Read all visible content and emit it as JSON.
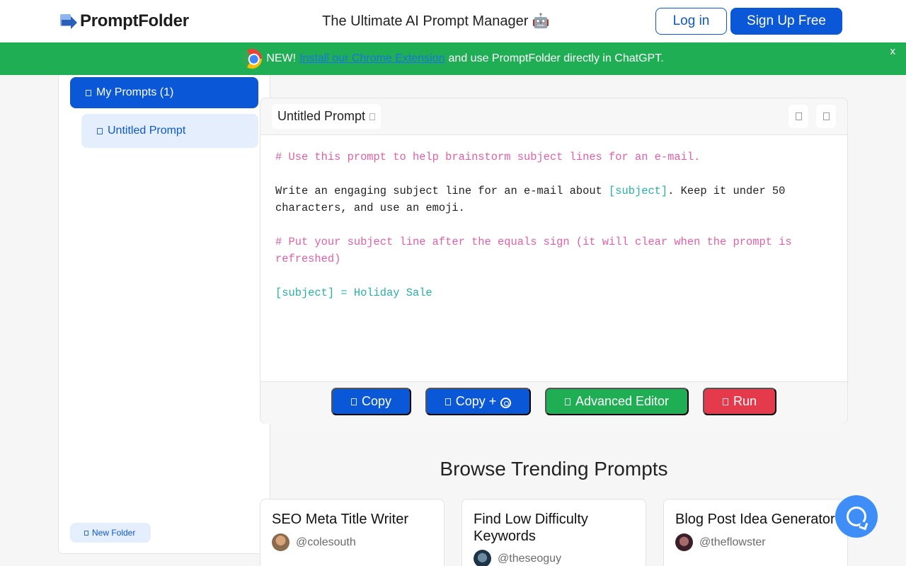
{
  "header": {
    "logo_text": "PromptFolder",
    "tagline": "The Ultimate AI Prompt Manager 🤖",
    "login_label": "Log in",
    "signup_label": "Sign Up Free"
  },
  "banner": {
    "prefix": "NEW!",
    "link_text": "Install our Chrome Extension",
    "suffix": "and use PromptFolder directly in ChatGPT.",
    "close_label": "x"
  },
  "sidebar": {
    "folder_label": "My Prompts (1)",
    "items": [
      {
        "label": "Untitled Prompt"
      }
    ],
    "new_folder_label": "New Folder"
  },
  "editor": {
    "title": "Untitled Prompt",
    "lines": {
      "comment1": "# Use this prompt to help brainstorm subject lines for an e-mail.",
      "body_pre": "Write an engaging subject line for an e-mail about ",
      "body_var": "[subject]",
      "body_post": ". Keep it under 50 characters, and use an emoji.",
      "comment2": "# Put your subject line after the equals sign (it will clear when the prompt is refreshed)",
      "assignment": "[subject] = Holiday Sale"
    },
    "actions": {
      "copy": "Copy",
      "copy_plus": "Copy +",
      "advanced": "Advanced Editor",
      "run": "Run"
    }
  },
  "trending": {
    "heading": "Browse Trending Prompts",
    "cards": [
      {
        "title": "SEO Meta Title Writer",
        "user": "@colesouth"
      },
      {
        "title": "Find Low Difficulty Keywords",
        "user": "@theseoguy"
      },
      {
        "title": "Blog Post Idea Generator",
        "user": "@theflowster"
      }
    ]
  },
  "colors": {
    "primary": "#0a58d8",
    "banner_green": "#1fae54",
    "run_red": "#e43a4b",
    "comment_pink": "#e45fa4",
    "variable_teal": "#26b0a8"
  },
  "icons": [
    "logo-icon",
    "chrome-icon",
    "folder-icon",
    "prompt-icon",
    "edit-icon",
    "share-icon",
    "delete-icon",
    "copy-icon",
    "chatgpt-icon",
    "advanced-icon",
    "run-icon",
    "help-chat-icon"
  ]
}
